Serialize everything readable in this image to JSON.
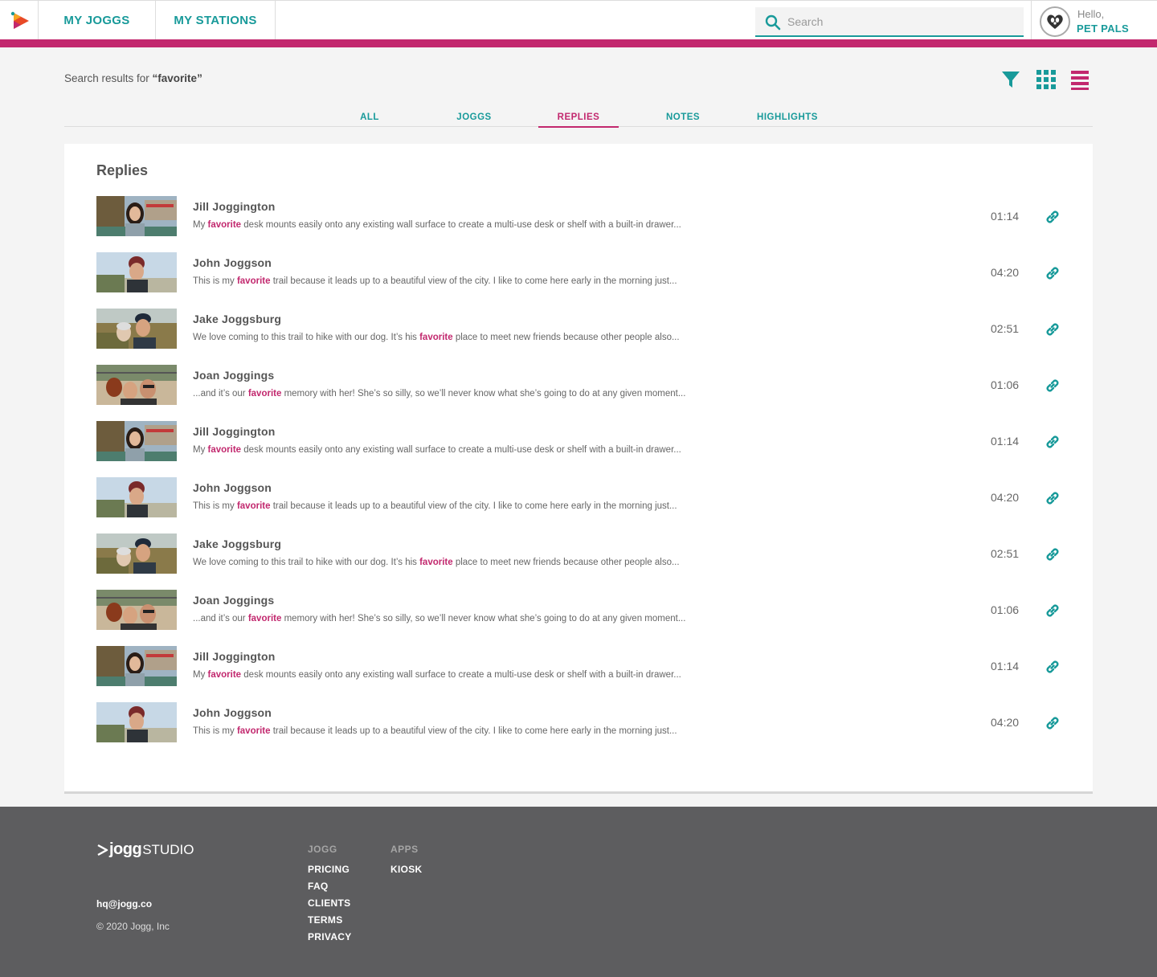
{
  "nav": {
    "tabs": [
      "MY JOGGS",
      "MY STATIONS"
    ]
  },
  "search": {
    "placeholder": "Search",
    "value": ""
  },
  "user": {
    "greeting": "Hello,",
    "name": "PET PALS"
  },
  "results": {
    "prefix": "Search results for ",
    "query": "“favorite”"
  },
  "tabs": [
    {
      "label": "ALL",
      "active": false
    },
    {
      "label": "JOGGS",
      "active": false
    },
    {
      "label": "REPLIES",
      "active": true
    },
    {
      "label": "NOTES",
      "active": false
    },
    {
      "label": "HIGHLIGHTS",
      "active": false
    }
  ],
  "section_title": "Replies",
  "highlight_word": "favorite",
  "replies": [
    {
      "name": "Jill Joggington",
      "before": "My ",
      "after": " desk mounts easily onto any existing wall surface to create a multi-use desk or shelf with a built-in drawer...",
      "time": "01:14"
    },
    {
      "name": "John Joggson",
      "before": "This is my ",
      "after": " trail because it leads up to a beautiful view of the city. I like to come here early in the morning just...",
      "time": "04:20"
    },
    {
      "name": "Jake Joggsburg",
      "before": "We love coming to this trail to hike with our dog. It’s his ",
      "after": " place to meet new friends because other people also...",
      "time": "02:51"
    },
    {
      "name": "Joan Joggings",
      "before": "...and it’s our ",
      "after": " memory with her! She’s so silly, so we’ll never know what she’s going to do at any given moment...",
      "time": "01:06"
    },
    {
      "name": "Jill Joggington",
      "before": "My ",
      "after": " desk mounts easily onto any existing wall surface to create a multi-use desk or shelf with a built-in drawer...",
      "time": "01:14"
    },
    {
      "name": "John Joggson",
      "before": "This is my ",
      "after": " trail because it leads up to a beautiful view of the city. I like to come here early in the morning just...",
      "time": "04:20"
    },
    {
      "name": "Jake Joggsburg",
      "before": "We love coming to this trail to hike with our dog. It’s his ",
      "after": " place to meet new friends because other people also...",
      "time": "02:51"
    },
    {
      "name": "Joan Joggings",
      "before": "...and it’s our ",
      "after": " memory with her! She’s so silly, so we’ll never know what she’s going to do at any given moment...",
      "time": "01:06"
    },
    {
      "name": "Jill Joggington",
      "before": "My ",
      "after": " desk mounts easily onto any existing wall surface to create a multi-use desk or shelf with a built-in drawer...",
      "time": "01:14"
    },
    {
      "name": "John Joggson",
      "before": "This is my ",
      "after": " trail because it leads up to a beautiful view of the city. I like to come here early in the morning just...",
      "time": "04:20"
    }
  ],
  "footer": {
    "logo_bold": "jogg",
    "logo_light": "STUDIO",
    "email": "hq@jogg.co",
    "copyright": "© 2020 Jogg, Inc",
    "col1_heading": "JOGG",
    "col1_links": [
      "PRICING",
      "FAQ",
      "CLIENTS",
      "TERMS",
      "PRIVACY"
    ],
    "col2_heading": "APPS",
    "col2_links": [
      "KIOSK"
    ]
  },
  "colors": {
    "teal": "#189a9a",
    "magenta": "#c2286e",
    "footer": "#5d5d5f"
  }
}
